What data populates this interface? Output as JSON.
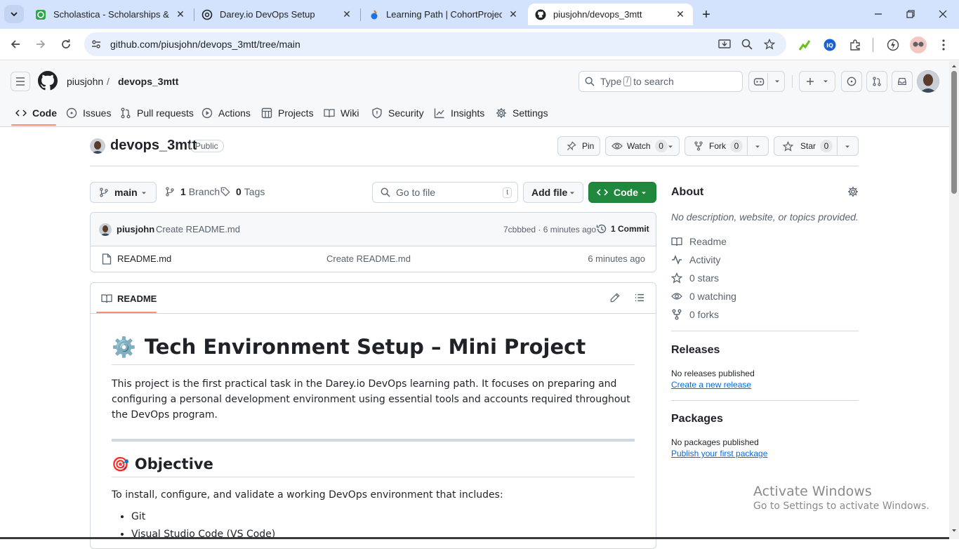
{
  "browser": {
    "tabs": [
      {
        "title": "Scholastica - Scholarships & Bu",
        "icon": "scholastica-favicon"
      },
      {
        "title": "Darey.io DevOps Setup",
        "icon": "chatgpt-favicon"
      },
      {
        "title": "Learning Path | CohortProject | ",
        "icon": "darey-favicon"
      },
      {
        "title": "piusjohn/devops_3mtt",
        "icon": "github-favicon",
        "active": true
      }
    ],
    "url": "github.com/piusjohn/devops_3mtt/tree/main"
  },
  "header": {
    "owner": "piusjohn",
    "separator": "/",
    "repo": "devops_3mtt",
    "search_prefix": "Type",
    "search_key": "/",
    "search_suffix": "to search"
  },
  "repo_tabs": [
    "Code",
    "Issues",
    "Pull requests",
    "Actions",
    "Projects",
    "Wiki",
    "Security",
    "Insights",
    "Settings"
  ],
  "repo": {
    "name": "devops_3mtt",
    "visibility": "Public",
    "pin_label": "Pin",
    "watch_label": "Watch",
    "watch_count": "0",
    "fork_label": "Fork",
    "fork_count": "0",
    "star_label": "Star",
    "star_count": "0"
  },
  "branch_bar": {
    "branch": "main",
    "branch_count": "1",
    "branch_label": "Branch",
    "tag_count": "0",
    "tag_label": "Tags",
    "go_to_file": "Go to file",
    "go_to_file_key": "t",
    "add_file": "Add file",
    "code_button": "Code"
  },
  "latest_commit": {
    "author": "piusjohn",
    "message": "Create README.md",
    "hash_time": "7cbbbed · 6 minutes ago",
    "commits_label": "1 Commit"
  },
  "files": [
    {
      "name": "README.md",
      "message": "Create README.md",
      "time": "6 minutes ago"
    }
  ],
  "readme": {
    "tab_label": "README",
    "h1_emoji": "⚙️",
    "h1": "Tech Environment Setup – Mini Project",
    "intro": "This project is the first practical task in the Darey.io DevOps learning path. It focuses on preparing and configuring a personal development environment using essential tools and accounts required throughout the DevOps program.",
    "h2_emoji": "🎯",
    "h2": "Objective",
    "objective_text": "To install, configure, and validate a working DevOps environment that includes:",
    "items": [
      "Git",
      "Visual Studio Code (VS Code)"
    ]
  },
  "about": {
    "title": "About",
    "description": "No description, website, or topics provided.",
    "readme": "Readme",
    "activity": "Activity",
    "stars": "0 stars",
    "watching": "0 watching",
    "forks": "0 forks"
  },
  "releases": {
    "title": "Releases",
    "empty": "No releases published",
    "link": "Create a new release"
  },
  "packages": {
    "title": "Packages",
    "empty": "No packages published",
    "link": "Publish your first package"
  },
  "watermark": {
    "line1": "Activate Windows",
    "line2": "Go to Settings to activate Windows."
  },
  "colors": {
    "chrome_tabstrip": "#d3e3fd",
    "code_button": "#1f883d",
    "link": "#0969da",
    "tab_underline": "#fd8c73"
  }
}
